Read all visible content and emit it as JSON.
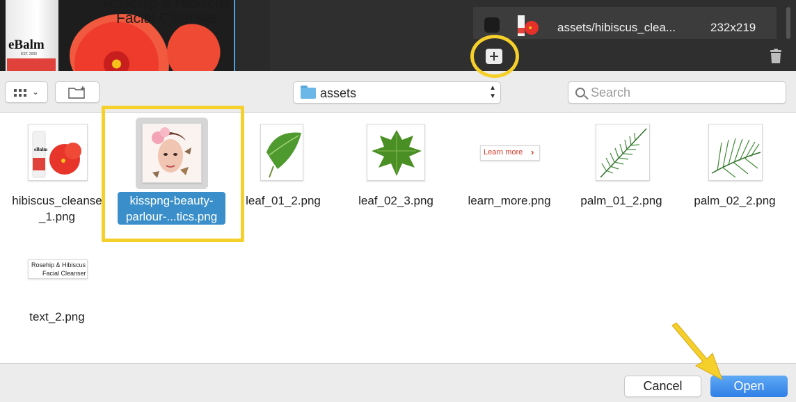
{
  "canvas": {
    "brand": "eBalm",
    "brand_sub": "EST. 2000",
    "title": "Rosehip & Hibiscus Facial Cleanser"
  },
  "layers": {
    "item": {
      "name": "assets/hibiscus_clea...",
      "size": "232x219"
    }
  },
  "dialog": {
    "path_label": "assets",
    "search_placeholder": "Search",
    "files": [
      {
        "name": "hibiscus_cleanser_1.png",
        "line1": "hibiscus_cleanse",
        "line2": "_1.png"
      },
      {
        "name": "kisspng-beauty-parlour-...tics.png",
        "line1": "kisspng-beauty-",
        "line2": "parlour-...tics.png"
      },
      {
        "name": "leaf_01_2.png",
        "line1": "leaf_01_2.png"
      },
      {
        "name": "leaf_02_3.png",
        "line1": "leaf_02_3.png"
      },
      {
        "name": "learn_more.png",
        "line1": "learn_more.png"
      },
      {
        "name": "palm_01_2.png",
        "line1": "palm_01_2.png"
      },
      {
        "name": "palm_02_2.png",
        "line1": "palm_02_2.png"
      },
      {
        "name": "text_2.png",
        "line1": "text_2.png"
      }
    ],
    "learn_more_text": "Learn more",
    "text_thumb_line1": "Rosehip & Hibiscus",
    "text_thumb_line2": "Facial Cleanser",
    "cancel_label": "Cancel",
    "open_label": "Open"
  },
  "colors": {
    "selection": "#3a8fca",
    "highlight": "#f5cf2a",
    "primary_button": "#2f7fe6"
  }
}
